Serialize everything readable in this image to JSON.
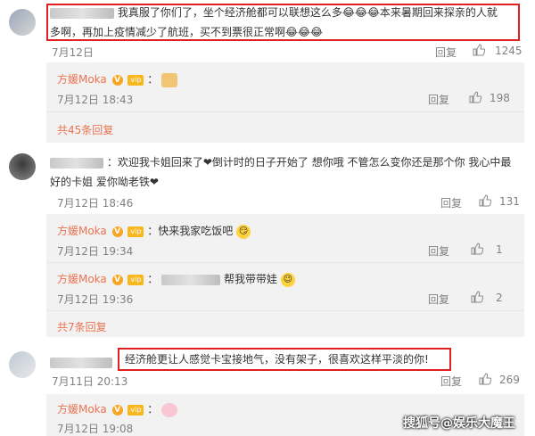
{
  "comments": [
    {
      "text_line1": "我真服了你们了，坐个经济舱都可以联想这么多😂😂😂本来暑期回来探亲的人就",
      "text_line2": "多啊，再加上疫情减少了航班，买不到票很正常啊😂😂😂",
      "date": "7月12日",
      "reply": "回复",
      "likes": "1245",
      "replies": [
        {
          "name": "方媛Moka",
          "date": "7月12日 18:43",
          "reply": "回复",
          "likes": "198"
        }
      ],
      "more": "共45条回复"
    },
    {
      "text_line1": "：欢迎我卡姐回来了❤倒计时的日子开始了 想你哦 不管怎么变你还是那个你 我心中最",
      "text_line2": "好的卡姐 爱你呦老铁❤",
      "date": "7月12日 18:46",
      "reply": "回复",
      "likes": "131",
      "replies": [
        {
          "name": "方媛Moka",
          "text": "：快来我家吃饭吧",
          "date": "7月12日 19:34",
          "reply": "回复",
          "likes": "1"
        },
        {
          "name": "方媛Moka",
          "text": "帮我带带娃",
          "date": "7月12日 19:36",
          "reply": "回复",
          "likes": "2"
        }
      ],
      "more": "共7条回复"
    },
    {
      "text": "经济舱更让人感觉卡宝接地气，没有架子，很喜欢这样平淡的你!",
      "date": "7月11日 20:13",
      "reply": "回复",
      "likes": "269",
      "replies": [
        {
          "name": "方媛Moka",
          "date": "7月12日 19:08"
        }
      ]
    }
  ],
  "watermark": "搜狐号@娱乐大魔王",
  "colors": {
    "highlight_frame": "#e02020",
    "name": "#eb7350",
    "reply_bg": "#f2f2f2"
  }
}
